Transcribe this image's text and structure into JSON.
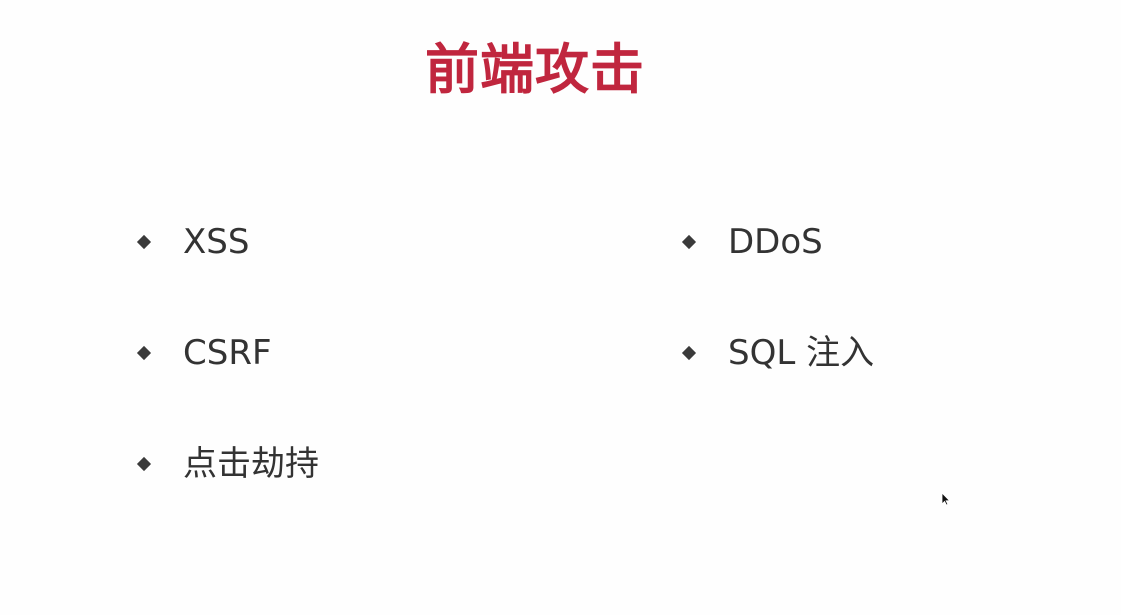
{
  "slide": {
    "title": "前端攻击",
    "left_items": [
      {
        "label": "XSS"
      },
      {
        "label": "CSRF"
      },
      {
        "label": "点击劫持"
      }
    ],
    "right_items": [
      {
        "label": "DDoS"
      },
      {
        "label": "SQL 注入"
      }
    ]
  },
  "colors": {
    "title": "#c0263e",
    "text": "#333333",
    "bullet": "#3a3a3a",
    "background": "#fefefe"
  },
  "icons": {
    "bullet": "diamond-bullet-icon",
    "pointer": "mouse-pointer-icon"
  }
}
